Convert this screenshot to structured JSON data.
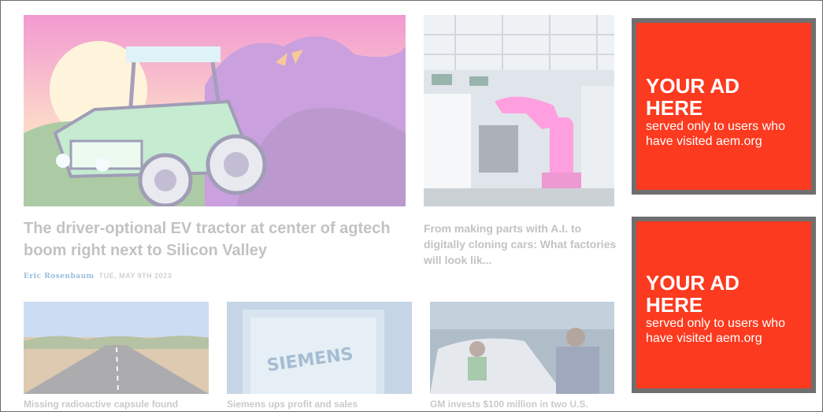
{
  "featured": {
    "headline": "The driver-optional EV tractor at center of agtech boom right next to Silicon Valley",
    "author": "Eric Rosenbaum",
    "date": "TUE, MAY 9TH 2023"
  },
  "secondary": {
    "headline": "From making parts with A.I. to digitally cloning cars: What factories will look lik..."
  },
  "bottom_stories": [
    {
      "headline": "Missing radioactive capsule found"
    },
    {
      "headline": "Siemens ups profit and sales"
    },
    {
      "headline": "GM invests $100 million in two U.S."
    }
  ],
  "siemens_sign_text": "SIEMENS",
  "ads": [
    {
      "title": "YOUR AD HERE",
      "body": "served only to users who have visited aem.org"
    },
    {
      "title": "YOUR AD HERE",
      "body": "served only to users who have visited aem.org"
    }
  ],
  "colors": {
    "ad_background": "#fc3a1f",
    "ad_border": "#6f6f6f",
    "author_link": "#1a6fb0"
  }
}
